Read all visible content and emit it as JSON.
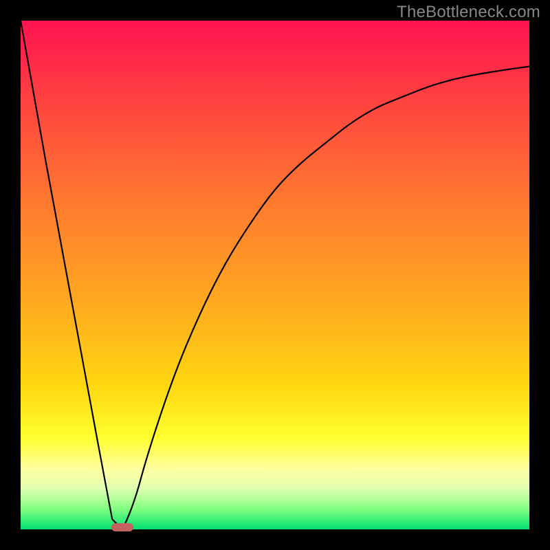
{
  "watermark": "TheBottleneck.com",
  "chart_data": {
    "type": "line",
    "title": "",
    "xlabel": "",
    "ylabel": "",
    "xlim": [
      0,
      100
    ],
    "ylim": [
      0,
      100
    ],
    "grid": false,
    "series": [
      {
        "name": "bottleneck-curve",
        "x": [
          0,
          5,
          10,
          15,
          18,
          20,
          22,
          25,
          30,
          35,
          40,
          45,
          50,
          55,
          60,
          65,
          70,
          75,
          80,
          85,
          90,
          95,
          100
        ],
        "values": [
          100,
          72,
          45,
          18,
          2,
          0,
          4,
          15,
          30,
          42,
          52,
          60,
          67,
          72,
          76,
          80,
          83,
          85,
          87,
          88.5,
          89.5,
          90.3,
          91
        ]
      }
    ],
    "annotations": [
      {
        "name": "optimal-marker",
        "x": 20,
        "y": 0
      }
    ],
    "background_gradient": {
      "direction": "top-to-bottom",
      "stops": [
        {
          "pos": 0.0,
          "color": "#ff1450"
        },
        {
          "pos": 0.35,
          "color": "#ff7830"
        },
        {
          "pos": 0.72,
          "color": "#ffd810"
        },
        {
          "pos": 0.88,
          "color": "#ffffa0"
        },
        {
          "pos": 1.0,
          "color": "#00e070"
        }
      ]
    }
  }
}
